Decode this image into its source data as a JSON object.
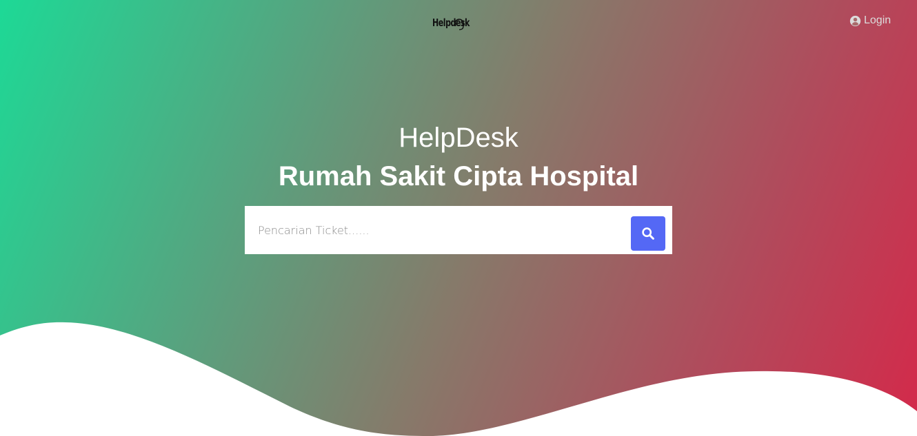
{
  "header": {
    "logo_text": "Helpdesk",
    "login_label": "Login"
  },
  "hero": {
    "title": "HelpDesk",
    "subtitle": "Rumah Sakit Cipta Hospital"
  },
  "search": {
    "placeholder": "Pencarian Ticket......",
    "value": ""
  },
  "icons": {
    "logo": "headset-icon",
    "login": "user-circle-icon",
    "search": "search-icon"
  },
  "colors": {
    "gradient_start": "#1dd996",
    "gradient_end": "#d4294a",
    "search_button": "#5468f5"
  }
}
